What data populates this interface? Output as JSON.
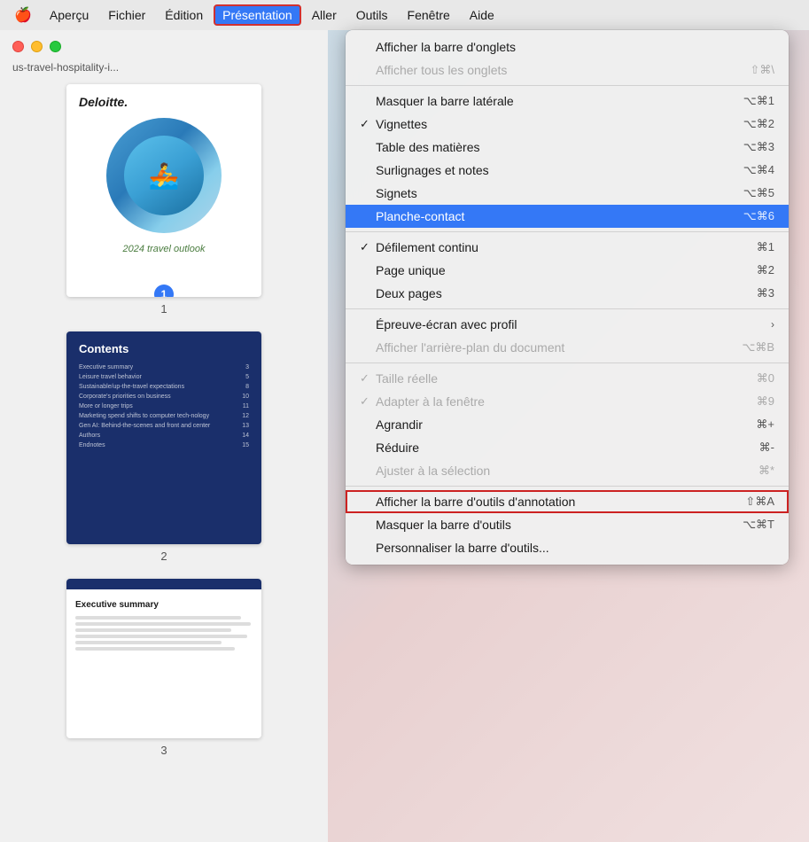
{
  "menubar": {
    "apple": "🍎",
    "items": [
      {
        "id": "apercu",
        "label": "Aperçu"
      },
      {
        "id": "fichier",
        "label": "Fichier"
      },
      {
        "id": "edition",
        "label": "Édition"
      },
      {
        "id": "presentation",
        "label": "Présentation",
        "active": true
      },
      {
        "id": "aller",
        "label": "Aller"
      },
      {
        "id": "outils",
        "label": "Outils"
      },
      {
        "id": "fenetre",
        "label": "Fenêtre"
      },
      {
        "id": "aide",
        "label": "Aide"
      }
    ]
  },
  "sidebar": {
    "title": "us-travel-hospitality-i...",
    "pages": [
      {
        "number": "1",
        "badge": "1"
      },
      {
        "number": "2"
      },
      {
        "number": "3"
      }
    ]
  },
  "page1": {
    "logo": "Deloitte.",
    "title": "2024 travel outlook",
    "emoji": "🚣"
  },
  "page2": {
    "contents_label": "Contents",
    "rows": [
      {
        "label": "Executive summary",
        "page": "3"
      },
      {
        "label": "Leisure travel behavior",
        "page": "5"
      },
      {
        "label": "Sustainable/up-the-travel expectations",
        "page": "8"
      },
      {
        "label": "Corporate's priorities on business",
        "page": "10"
      },
      {
        "label": "More or longer trips",
        "page": "11"
      },
      {
        "label": "Marketing spend shifts to computer tech-nology",
        "page": "12"
      },
      {
        "label": "Gen AI: Behind-the-scenes and front and center",
        "page": "13"
      },
      {
        "label": "Authors",
        "page": "14"
      },
      {
        "label": "Endnotes",
        "page": "15"
      }
    ]
  },
  "page3": {
    "title": "Executive summary"
  },
  "menu": {
    "sections": [
      {
        "items": [
          {
            "id": "afficher-barre-onglets",
            "check": "",
            "label": "Afficher la barre d'onglets",
            "shortcut": "",
            "disabled": false
          },
          {
            "id": "afficher-tous-onglets",
            "check": "",
            "label": "Afficher tous les onglets",
            "shortcut": "⇧⌘\\",
            "disabled": true
          }
        ]
      },
      {
        "items": [
          {
            "id": "masquer-barre-laterale",
            "check": "",
            "label": "Masquer la barre latérale",
            "shortcut": "⌥⌘1",
            "disabled": false
          },
          {
            "id": "vignettes",
            "check": "✓",
            "label": "Vignettes",
            "shortcut": "⌥⌘2",
            "disabled": false
          },
          {
            "id": "table-matieres",
            "check": "",
            "label": "Table des matières",
            "shortcut": "⌥⌘3",
            "disabled": false
          },
          {
            "id": "surlignages-notes",
            "check": "",
            "label": "Surlignages et notes",
            "shortcut": "⌥⌘4",
            "disabled": false
          },
          {
            "id": "signets",
            "check": "",
            "label": "Signets",
            "shortcut": "⌥⌘5",
            "disabled": false
          },
          {
            "id": "planche-contact",
            "check": "",
            "label": "Planche-contact",
            "shortcut": "⌥⌘6",
            "highlighted": true,
            "disabled": false
          }
        ]
      },
      {
        "items": [
          {
            "id": "defilement-continu",
            "check": "✓",
            "label": "Défilement continu",
            "shortcut": "⌘1",
            "disabled": false
          },
          {
            "id": "page-unique",
            "check": "",
            "label": "Page unique",
            "shortcut": "⌘2",
            "disabled": false
          },
          {
            "id": "deux-pages",
            "check": "",
            "label": "Deux pages",
            "shortcut": "⌘3",
            "disabled": false
          }
        ]
      },
      {
        "items": [
          {
            "id": "epreuve-ecran",
            "check": "",
            "label": "Épreuve-écran avec profil",
            "shortcut": "",
            "arrow": "›",
            "disabled": false
          },
          {
            "id": "afficher-arriere-plan",
            "check": "",
            "label": "Afficher l'arrière-plan du document",
            "shortcut": "⌥⌘B",
            "disabled": true
          }
        ]
      },
      {
        "items": [
          {
            "id": "taille-reelle",
            "check": "✓",
            "label": "Taille réelle",
            "shortcut": "⌘0",
            "disabled": true
          },
          {
            "id": "adapter-fenetre",
            "check": "✓",
            "label": "Adapter à la fenêtre",
            "shortcut": "⌘9",
            "disabled": true
          },
          {
            "id": "agrandir",
            "check": "",
            "label": "Agrandir",
            "shortcut": "⌘+",
            "disabled": false
          },
          {
            "id": "reduire",
            "check": "",
            "label": "Réduire",
            "shortcut": "⌘-",
            "disabled": false
          },
          {
            "id": "ajuster-selection",
            "check": "",
            "label": "Ajuster à la sélection",
            "shortcut": "⌘*",
            "disabled": true
          }
        ]
      },
      {
        "items": [
          {
            "id": "afficher-barre-annotation",
            "check": "",
            "label": "Afficher la barre d'outils d'annotation",
            "shortcut": "⇧⌘A",
            "disabled": false,
            "boxed": true
          },
          {
            "id": "masquer-barre-outils",
            "check": "",
            "label": "Masquer la barre d'outils",
            "shortcut": "⌥⌘T",
            "disabled": false
          },
          {
            "id": "personnaliser-barre",
            "check": "",
            "label": "Personnaliser la barre d'outils...",
            "shortcut": "",
            "disabled": false
          }
        ]
      }
    ]
  }
}
